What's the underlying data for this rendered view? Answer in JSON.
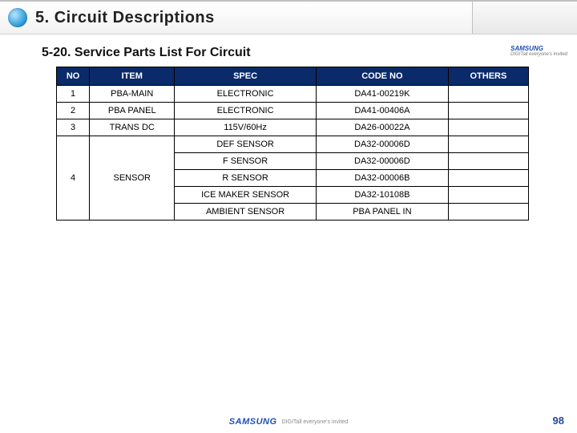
{
  "header": {
    "title": "5. Circuit Descriptions"
  },
  "subheader": "5-20. Service Parts List For Circuit",
  "brand": {
    "logo": "SAMSUNG",
    "tagline": "DIGITall everyone's invited"
  },
  "page_number": "98",
  "table": {
    "columns": [
      "NO",
      "ITEM",
      "SPEC",
      "CODE NO",
      "OTHERS"
    ],
    "rows": [
      {
        "no": "1",
        "item": "PBA-MAIN",
        "spec": "ELECTRONIC",
        "code": "DA41-00219K",
        "others": ""
      },
      {
        "no": "2",
        "item": "PBA PANEL",
        "spec": "ELECTRONIC",
        "code": "DA41-00406A",
        "others": ""
      },
      {
        "no": "3",
        "item": "TRANS DC",
        "spec": "115V/60Hz",
        "code": "DA26-00022A",
        "others": ""
      }
    ],
    "group4": {
      "no": "4",
      "item": "SENSOR",
      "specs": [
        {
          "spec": "DEF SENSOR",
          "code": "DA32-00006D",
          "others": ""
        },
        {
          "spec": "F SENSOR",
          "code": "DA32-00006D",
          "others": ""
        },
        {
          "spec": "R SENSOR",
          "code": "DA32-00006B",
          "others": ""
        },
        {
          "spec": "ICE MAKER SENSOR",
          "code": "DA32-10108B",
          "others": ""
        },
        {
          "spec": "AMBIENT SENSOR",
          "code": "PBA PANEL IN",
          "others": ""
        }
      ]
    }
  },
  "chart_data": {
    "type": "table",
    "title": "Service Parts List For Circuit",
    "columns": [
      "NO",
      "ITEM",
      "SPEC",
      "CODE NO",
      "OTHERS"
    ],
    "rows": [
      [
        "1",
        "PBA-MAIN",
        "ELECTRONIC",
        "DA41-00219K",
        ""
      ],
      [
        "2",
        "PBA PANEL",
        "ELECTRONIC",
        "DA41-00406A",
        ""
      ],
      [
        "3",
        "TRANS DC",
        "115V/60Hz",
        "DA26-00022A",
        ""
      ],
      [
        "4",
        "SENSOR",
        "DEF SENSOR",
        "DA32-00006D",
        ""
      ],
      [
        "4",
        "SENSOR",
        "F SENSOR",
        "DA32-00006D",
        ""
      ],
      [
        "4",
        "SENSOR",
        "R SENSOR",
        "DA32-00006B",
        ""
      ],
      [
        "4",
        "SENSOR",
        "ICE MAKER SENSOR",
        "DA32-10108B",
        ""
      ],
      [
        "4",
        "SENSOR",
        "AMBIENT SENSOR",
        "PBA PANEL IN",
        ""
      ]
    ]
  }
}
